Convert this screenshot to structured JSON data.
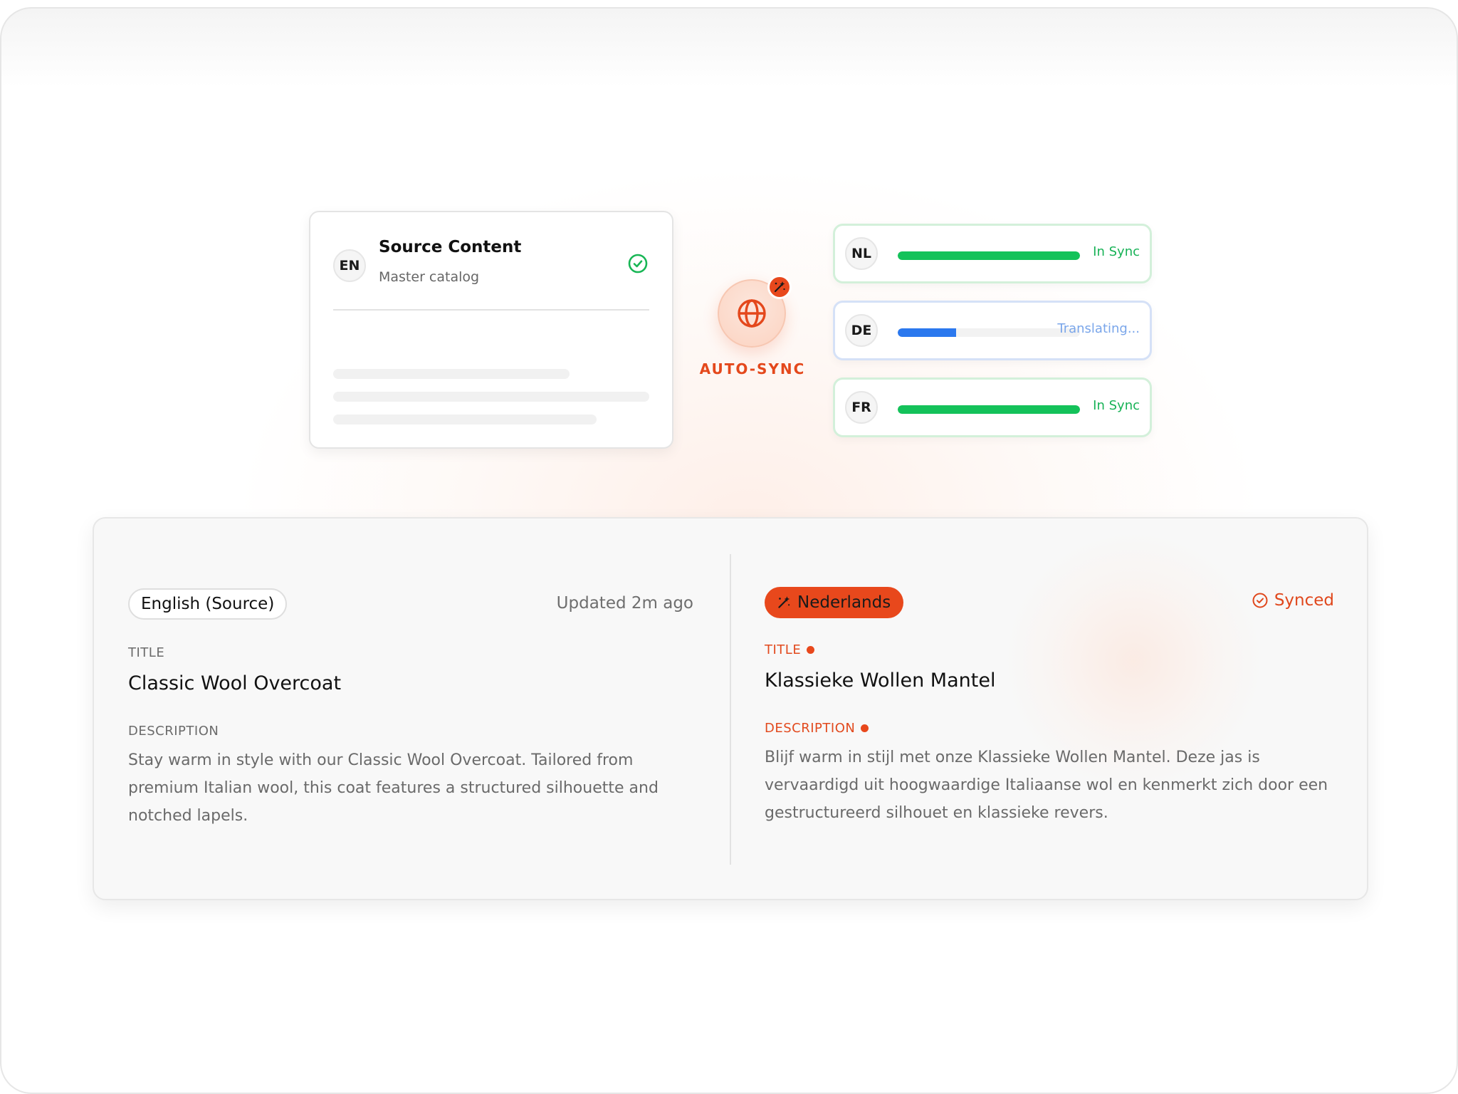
{
  "source_card": {
    "lang_code": "EN",
    "title": "Source Content",
    "subtitle": "Master catalog"
  },
  "hub": {
    "label": "AUTO-SYNC",
    "icon": "globe-icon",
    "badge_icon": "magic-wand-icon"
  },
  "languages": [
    {
      "code": "NL",
      "status": "In Sync",
      "progress": 1.0,
      "state": "synced"
    },
    {
      "code": "DE",
      "status": "Translating...",
      "progress": 0.32,
      "state": "translating"
    },
    {
      "code": "FR",
      "status": "In Sync",
      "progress": 1.0,
      "state": "synced"
    }
  ],
  "comparison": {
    "source": {
      "badge": "English (Source)",
      "updated": "Updated 2m ago",
      "title_label": "TITLE",
      "title": "Classic Wool Overcoat",
      "description_label": "DESCRIPTION",
      "description": "Stay warm in style with our Classic Wool Overcoat. Tailored from premium Italian wool, this coat features a structured silhouette and notched lapels."
    },
    "target": {
      "badge": "Nederlands",
      "status": "Synced",
      "title_label": "TITLE",
      "title": "Klassieke Wollen Mantel",
      "description_label": "DESCRIPTION",
      "description": "Blijf warm in stijl met onze Klassieke Wollen Mantel. Deze jas is vervaardigd uit hoogwaardige Italiaanse wol en kenmerkt zich door een gestructureerd silhouet en klassieke revers."
    }
  },
  "colors": {
    "accent": "#e8481c",
    "synced_green": "#14c25a",
    "translating_blue": "#2b78ee"
  }
}
